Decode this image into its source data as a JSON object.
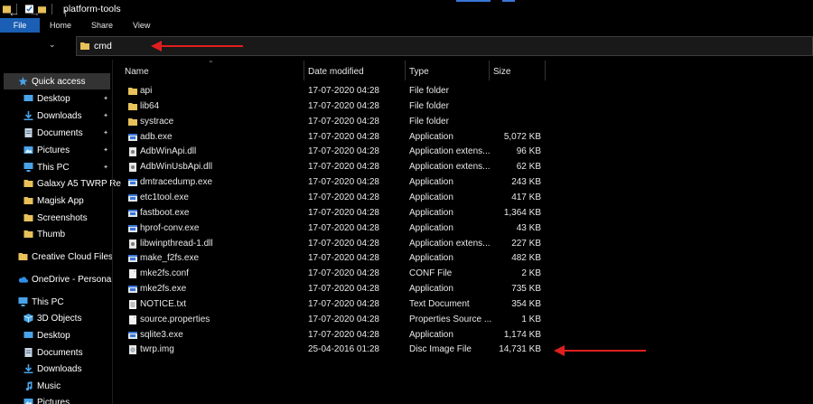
{
  "window": {
    "title": "platform-tools"
  },
  "ribbon": {
    "tabs": [
      "File",
      "Home",
      "Share",
      "View"
    ]
  },
  "address": {
    "path": "cmd"
  },
  "nav": {
    "quick_access": "Quick access",
    "items": [
      {
        "label": "Desktop",
        "icon": "desktop-icon",
        "pinned": true
      },
      {
        "label": "Downloads",
        "icon": "downloads-icon",
        "pinned": true
      },
      {
        "label": "Documents",
        "icon": "documents-icon",
        "pinned": true
      },
      {
        "label": "Pictures",
        "icon": "pictures-icon",
        "pinned": true
      },
      {
        "label": "This PC",
        "icon": "this-pc-icon",
        "pinned": true
      },
      {
        "label": "Galaxy A5 TWRP Re",
        "icon": "folder-icon",
        "pinned": false
      },
      {
        "label": "Magisk App",
        "icon": "folder-icon",
        "pinned": false
      },
      {
        "label": "Screenshots",
        "icon": "folder-icon",
        "pinned": false
      },
      {
        "label": "Thumb",
        "icon": "folder-icon",
        "pinned": false
      }
    ],
    "creative_cloud": "Creative Cloud Files",
    "onedrive": "OneDrive - Personal",
    "this_pc": "This PC",
    "pc_items": [
      {
        "label": "3D Objects",
        "icon": "3d-objects-icon"
      },
      {
        "label": "Desktop",
        "icon": "desktop-icon"
      },
      {
        "label": "Documents",
        "icon": "documents-icon"
      },
      {
        "label": "Downloads",
        "icon": "downloads-icon"
      },
      {
        "label": "Music",
        "icon": "music-icon"
      },
      {
        "label": "Pictures",
        "icon": "pictures-icon"
      }
    ]
  },
  "columns": {
    "name": "Name",
    "date": "Date modified",
    "type": "Type",
    "size": "Size"
  },
  "files": [
    {
      "name": "api",
      "date": "17-07-2020 04:28",
      "type": "File folder",
      "size": "",
      "kind": "folder"
    },
    {
      "name": "lib64",
      "date": "17-07-2020 04:28",
      "type": "File folder",
      "size": "",
      "kind": "folder"
    },
    {
      "name": "systrace",
      "date": "17-07-2020 04:28",
      "type": "File folder",
      "size": "",
      "kind": "folder"
    },
    {
      "name": "adb.exe",
      "date": "17-07-2020 04:28",
      "type": "Application",
      "size": "5,072 KB",
      "kind": "exe"
    },
    {
      "name": "AdbWinApi.dll",
      "date": "17-07-2020 04:28",
      "type": "Application extens...",
      "size": "96 KB",
      "kind": "dll"
    },
    {
      "name": "AdbWinUsbApi.dll",
      "date": "17-07-2020 04:28",
      "type": "Application extens...",
      "size": "62 KB",
      "kind": "dll"
    },
    {
      "name": "dmtracedump.exe",
      "date": "17-07-2020 04:28",
      "type": "Application",
      "size": "243 KB",
      "kind": "exe"
    },
    {
      "name": "etc1tool.exe",
      "date": "17-07-2020 04:28",
      "type": "Application",
      "size": "417 KB",
      "kind": "exe"
    },
    {
      "name": "fastboot.exe",
      "date": "17-07-2020 04:28",
      "type": "Application",
      "size": "1,364 KB",
      "kind": "exe"
    },
    {
      "name": "hprof-conv.exe",
      "date": "17-07-2020 04:28",
      "type": "Application",
      "size": "43 KB",
      "kind": "exe"
    },
    {
      "name": "libwinpthread-1.dll",
      "date": "17-07-2020 04:28",
      "type": "Application extens...",
      "size": "227 KB",
      "kind": "dll"
    },
    {
      "name": "make_f2fs.exe",
      "date": "17-07-2020 04:28",
      "type": "Application",
      "size": "482 KB",
      "kind": "exe"
    },
    {
      "name": "mke2fs.conf",
      "date": "17-07-2020 04:28",
      "type": "CONF File",
      "size": "2 KB",
      "kind": "file"
    },
    {
      "name": "mke2fs.exe",
      "date": "17-07-2020 04:28",
      "type": "Application",
      "size": "735 KB",
      "kind": "exe"
    },
    {
      "name": "NOTICE.txt",
      "date": "17-07-2020 04:28",
      "type": "Text Document",
      "size": "354 KB",
      "kind": "txt"
    },
    {
      "name": "source.properties",
      "date": "17-07-2020 04:28",
      "type": "Properties Source ...",
      "size": "1 KB",
      "kind": "file"
    },
    {
      "name": "sqlite3.exe",
      "date": "17-07-2020 04:28",
      "type": "Application",
      "size": "1,174 KB",
      "kind": "exe"
    },
    {
      "name": "twrp.img",
      "date": "25-04-2016 01:28",
      "type": "Disc Image File",
      "size": "14,731 KB",
      "kind": "img"
    }
  ],
  "colors": {
    "accent": "#1a5fb4",
    "folder": "#e8c15a",
    "arrow": "#e01e1e",
    "selected": "#333333"
  }
}
